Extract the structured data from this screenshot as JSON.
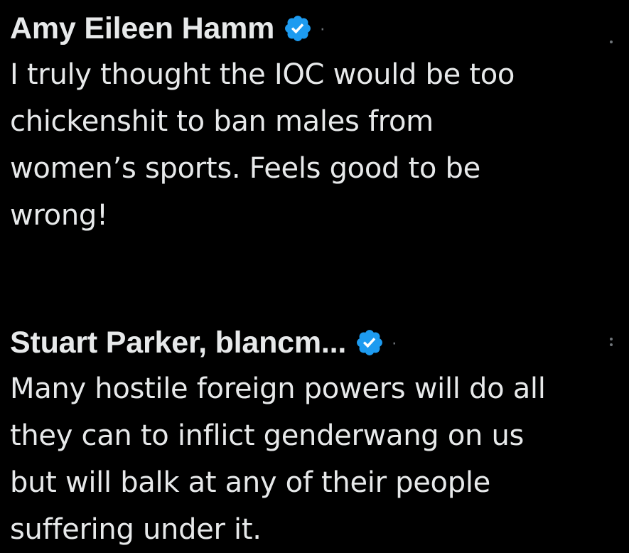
{
  "posts": [
    {
      "author": "Amy Eileen Hamm",
      "verified": true,
      "separator": "·",
      "text": "I truly thought the IOC would be too\nchickenshit to ban males from\nwomen’s sports. Feels good to be\nwrong!"
    },
    {
      "author": "Stuart Parker, blancm...",
      "verified": true,
      "separator": "·",
      "text": "Many hostile foreign powers will do all\nthey can to inflict genderwang on us\nbut will balk at any of their people\nsuffering under it."
    }
  ],
  "colors": {
    "background": "#000000",
    "text": "#e7e9ea",
    "verified_badge": "#1d9bf0",
    "muted": "#71767b"
  },
  "icons": {
    "verified": "verified-badge-icon",
    "more": "more-options-icon"
  }
}
